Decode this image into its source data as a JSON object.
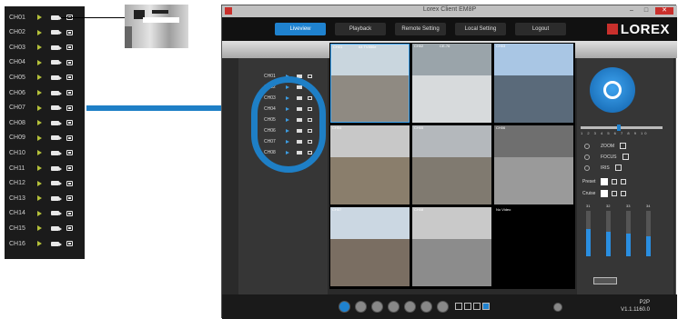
{
  "channels": [
    "CH01",
    "CH02",
    "CH03",
    "CH04",
    "CH05",
    "CH06",
    "CH07",
    "CH08",
    "CH09",
    "CH10",
    "CH11",
    "CH12",
    "CH13",
    "CH14",
    "CH15",
    "CH16"
  ],
  "panel_channels": [
    "CH01",
    "CH02",
    "CH03",
    "CH04",
    "CH05",
    "CH06",
    "CH07",
    "CH08"
  ],
  "window": {
    "title": "Lorex Client EM8P",
    "minimize": "–",
    "maximize": "□",
    "close": "✕"
  },
  "tabs": [
    "Liveview",
    "Playback",
    "Remote Setting",
    "Local Setting",
    "Logout"
  ],
  "active_tab": 0,
  "logo": "LOREX",
  "cells": [
    {
      "label": "CH01",
      "sub": "64 TV850e"
    },
    {
      "label": "CH02",
      "sub": "CE-76"
    },
    {
      "label": "CH03",
      "sub": ""
    },
    {
      "label": "CH04",
      "sub": ""
    },
    {
      "label": "CH05",
      "sub": ""
    },
    {
      "label": "CH06",
      "sub": ""
    },
    {
      "label": "CH07",
      "sub": ""
    },
    {
      "label": "CH08",
      "sub": ""
    },
    {
      "label": "No Video",
      "sub": ""
    }
  ],
  "ptz_speed_ticks": "1 2 3 4 5 6 7 8 9 10",
  "ptz_params": [
    "ZOOM",
    "FOCUS",
    "IRIS"
  ],
  "preset_label": "Preset",
  "cruise_label": "Cruise",
  "bar_numbers": [
    "31",
    "32",
    "33",
    "34"
  ],
  "version": {
    "mode": "P2P",
    "number": "V1.1.1160.0"
  },
  "colors": {
    "accent": "#1f82cf",
    "callout": "#1e7fc6",
    "brand_red": "#c9302c",
    "play_green": "#b5c23a"
  }
}
